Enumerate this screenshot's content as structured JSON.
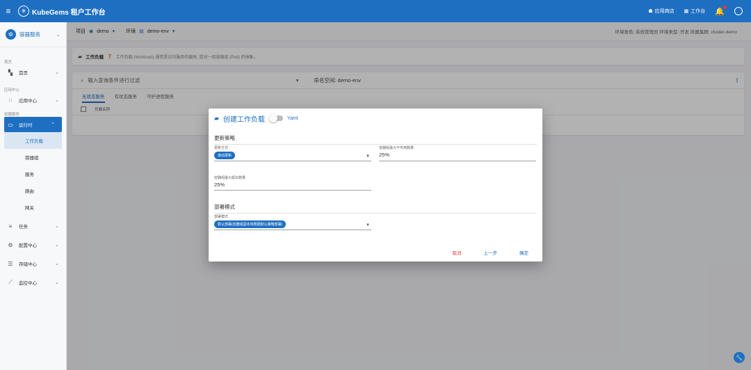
{
  "topbar": {
    "brand": "KubeGems 租户工作台",
    "app_store": "应用商店",
    "workspace": "工作台"
  },
  "sidebar": {
    "header": "容器服务",
    "sections": {
      "home": "首页",
      "app_center": "应用中心",
      "container_service": "容器服务"
    },
    "items": {
      "home": "首页",
      "app_center": "应用中心",
      "runtime": "运行时",
      "tasks": "任务",
      "config_center": "配置中心",
      "storage_center": "存储中心",
      "monitor_center": "监控中心"
    },
    "sub_items": [
      "工作负载",
      "容器组",
      "服务",
      "路由",
      "网关"
    ]
  },
  "breadcrumb": {
    "project_label": "项目",
    "project": "demo",
    "env_label": "环境",
    "env": "demo-env",
    "info": "环境角色: 系统管理员   环境类型: 开发   所属集群: cluster-demo"
  },
  "info_card": {
    "title": "工作负载",
    "desc": "工作负载 (Workload) 通常是访问服务的载体, 是对一组容器组 (Pod) 的抽象。"
  },
  "list": {
    "search_placeholder": "输入查询条件进行过滤",
    "namespace": "命名空间: demo-env",
    "tabs": [
      "无状态服务",
      "有状态服务",
      "守护进程服务"
    ],
    "column": "负载名称"
  },
  "dialog": {
    "title": "创建工作负载",
    "yaml": "Yaml",
    "section_update": "更新策略",
    "update_method_label": "更新方式",
    "update_method_value": "滚动更新",
    "max_unavailable_label": "容器组最大不可用数量",
    "max_unavailable_value": "25%",
    "max_surge_label": "容器组最大超出数量",
    "max_surge_value": "25%",
    "section_deploy": "部署模式",
    "deploy_mode_label": "部署模式",
    "deploy_mode_value": "默认部署(容器组副本将根据默认策略部署)",
    "cancel": "取消",
    "prev": "上一步",
    "confirm": "确定"
  },
  "colors": {
    "primary": "#1e6fc1",
    "danger": "#e53935"
  }
}
